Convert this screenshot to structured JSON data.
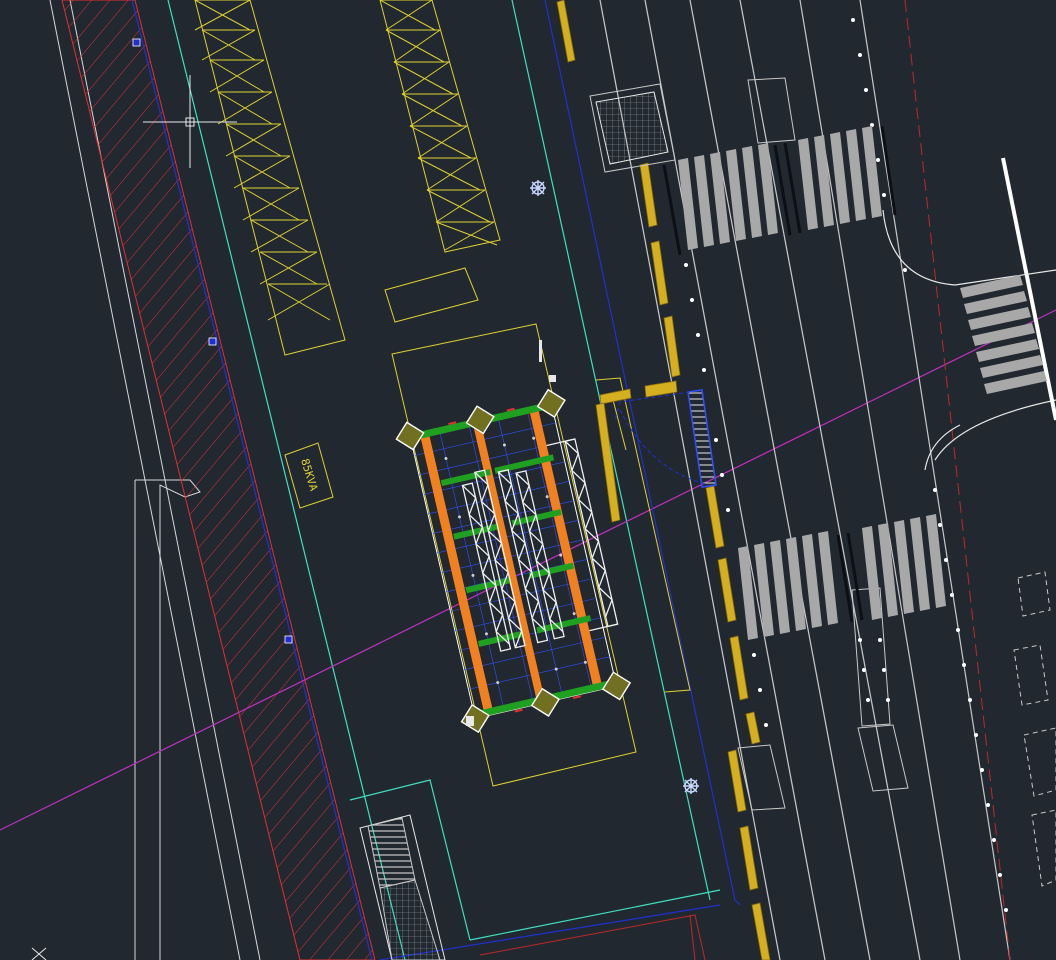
{
  "colors": {
    "background": "#212830",
    "boundary": "#ffffff",
    "hatch": "#e03030",
    "curb": "#40e0c0",
    "outline": "#e0d030",
    "property_line": "#2030d0",
    "axis": "#c030c0",
    "road": "#c8c8c8",
    "crossing": "#a8a8a8",
    "curb_marker": "#d4b020",
    "beam": "#f08020",
    "green_beam": "#20a020",
    "structure": "#e8e8e8",
    "stair": "#3050ff"
  },
  "icons": {
    "crosshair": "crosshair-cursor-icon",
    "tree": "tree-symbol-icon",
    "corner_x": "ucs-icon"
  },
  "labels": {
    "transformer": "85KVA"
  }
}
